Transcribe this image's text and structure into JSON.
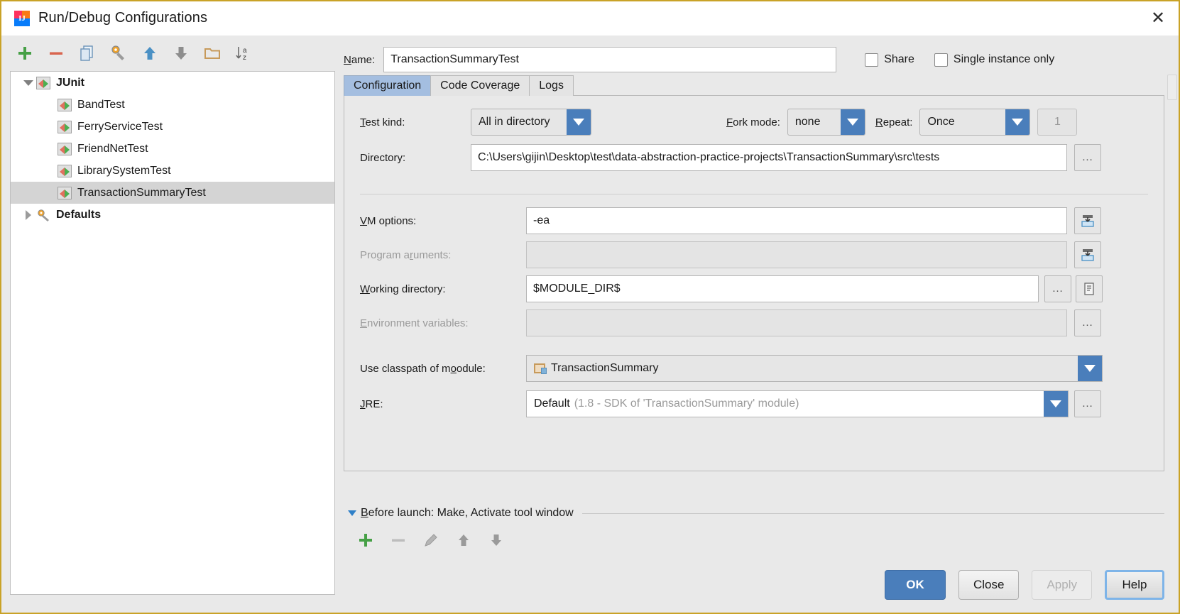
{
  "window": {
    "title": "Run/Debug Configurations",
    "close_label": "✕",
    "logo_mark": "IJ"
  },
  "tree_toolbar": {
    "items": [
      {
        "name": "add-configuration-button",
        "icon": "plus-icon",
        "tooltip": "Add New Configuration"
      },
      {
        "name": "remove-configuration-button",
        "icon": "minus-icon",
        "tooltip": "Remove Configuration"
      },
      {
        "name": "copy-configuration-button",
        "icon": "copy-icon",
        "tooltip": "Copy Configuration"
      },
      {
        "name": "edit-templates-button",
        "icon": "wrench-icon",
        "tooltip": "Edit Templates"
      },
      {
        "name": "move-up-button",
        "icon": "arrow-up-icon",
        "tooltip": "Move Up"
      },
      {
        "name": "move-down-button",
        "icon": "arrow-down-icon",
        "tooltip": "Move Down"
      },
      {
        "name": "create-folder-button",
        "icon": "folder-icon",
        "tooltip": "Create New Folder"
      },
      {
        "name": "sort-button",
        "icon": "sort-az-icon",
        "tooltip": "Sort Configurations"
      }
    ]
  },
  "tree": {
    "nodes": [
      {
        "label": "JUnit",
        "level": 1,
        "bold": true,
        "expanded": true,
        "icon": "junit-icon",
        "selected": false
      },
      {
        "label": "BandTest",
        "level": 2,
        "bold": false,
        "icon": "junit-icon",
        "selected": false
      },
      {
        "label": "FerryServiceTest",
        "level": 2,
        "bold": false,
        "icon": "junit-icon",
        "selected": false
      },
      {
        "label": "FriendNetTest",
        "level": 2,
        "bold": false,
        "icon": "junit-icon",
        "selected": false
      },
      {
        "label": "LibrarySystemTest",
        "level": 2,
        "bold": false,
        "icon": "junit-icon",
        "selected": false
      },
      {
        "label": "TransactionSummaryTest",
        "level": 2,
        "bold": false,
        "icon": "junit-icon",
        "selected": true
      },
      {
        "label": "Defaults",
        "level": 1,
        "bold": true,
        "expanded": false,
        "icon": "defaults-icon",
        "selected": false
      }
    ]
  },
  "name_row": {
    "label": "Name:",
    "value": "TransactionSummaryTest",
    "share": {
      "label": "Share",
      "checked": false
    },
    "single_instance": {
      "label": "Single instance only",
      "checked": false
    }
  },
  "tabs": [
    {
      "label": "Configuration",
      "active": true
    },
    {
      "label": "Code Coverage",
      "active": false
    },
    {
      "label": "Logs",
      "active": false
    }
  ],
  "config": {
    "test_kind": {
      "label": "Test kind:",
      "value": "All in directory"
    },
    "fork_mode": {
      "label": "Fork mode:",
      "value": "none"
    },
    "repeat": {
      "label": "Repeat:",
      "value": "Once",
      "count": "1",
      "count_enabled": false
    },
    "directory": {
      "label": "Directory:",
      "value": "C:\\Users\\gijin\\Desktop\\test\\data-abstraction-practice-projects\\TransactionSummary\\src\\tests",
      "browse": "…"
    },
    "vm_options": {
      "label": "VM options:",
      "value": "-ea",
      "expand_icon": "expand-editor-icon"
    },
    "program_arguments": {
      "label": "Program arguments:",
      "value": "",
      "enabled": false,
      "expand_icon": "expand-editor-icon"
    },
    "working_directory": {
      "label": "Working directory:",
      "value": "$MODULE_DIR$",
      "browse": "…",
      "macros_icon": "macros-icon"
    },
    "environment_variables": {
      "label": "Environment variables:",
      "value": "",
      "enabled": false,
      "browse": "…"
    },
    "use_classpath_of_module": {
      "label": "Use classpath of module:",
      "value": "TransactionSummary",
      "icon": "module-icon"
    },
    "jre": {
      "label": "JRE:",
      "value": "Default",
      "value_hint": "(1.8 - SDK of 'TransactionSummary' module)",
      "browse": "…"
    }
  },
  "before_launch": {
    "title": "Before launch: Make, Activate tool window",
    "expanded": true,
    "toolbar": [
      {
        "name": "add-before-launch-task-button",
        "icon": "plus-icon"
      },
      {
        "name": "remove-before-launch-task-button",
        "icon": "minus-icon",
        "enabled": false
      },
      {
        "name": "edit-before-launch-task-button",
        "icon": "pencil-icon",
        "enabled": false
      },
      {
        "name": "move-task-up-button",
        "icon": "arrow-up-icon"
      },
      {
        "name": "move-task-down-button",
        "icon": "arrow-down-icon"
      }
    ]
  },
  "buttons": {
    "ok": "OK",
    "close": "Close",
    "apply": "Apply",
    "help": "Help"
  },
  "colors": {
    "accent_blue": "#4a7ebb",
    "tab_active": "#a4bee0",
    "window_border": "#c9a227",
    "panel_bg": "#e9e9e9",
    "selection": "#d4d4d4",
    "disabled_text": "#9a9a9a"
  }
}
